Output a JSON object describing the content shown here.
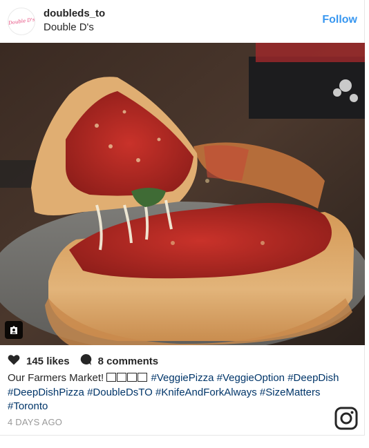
{
  "header": {
    "avatar_text": "Double D's",
    "username": "doubleds_to",
    "full_name": "Double D's",
    "follow_label": "Follow"
  },
  "photo": {
    "subject": "deep-dish-pizza"
  },
  "stats": {
    "likes": "145 likes",
    "comments": "8 comments"
  },
  "caption": {
    "text": "Our Farmers Market!",
    "glyph_count": 4,
    "hashtags": [
      "#VeggiePizza",
      "#VeggieOption",
      "#DeepDish",
      "#DeepDishPizza",
      "#DoubleDsTO",
      "#KnifeAndForkAlways",
      "#SizeMatters",
      "#Toronto"
    ]
  },
  "timestamp": "4 DAYS AGO",
  "colors": {
    "accent": "#3897f0",
    "hashtag": "#003569",
    "text": "#262626",
    "muted": "#999999"
  },
  "icons": [
    "heart-icon",
    "comment-bubble-icon",
    "tag-user-icon",
    "instagram-logo-icon"
  ]
}
